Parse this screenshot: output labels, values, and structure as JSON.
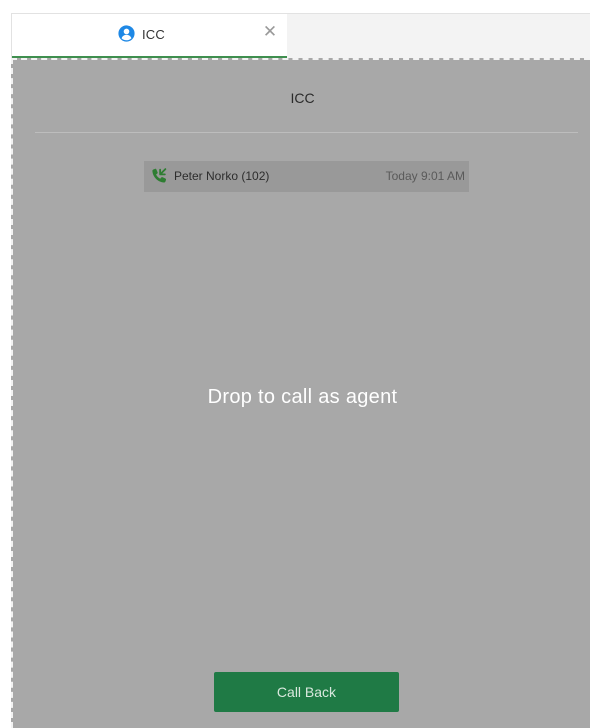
{
  "tab": {
    "label": "ICC",
    "icon": "user-circle-icon",
    "close_icon": "close-icon",
    "active_color": "#3f8f4f",
    "icon_color": "#1e88e5"
  },
  "panel": {
    "title": "ICC"
  },
  "call_history": [
    {
      "caller": "Peter Norko (102)",
      "time": "Today 9:01 AM",
      "icon": "incoming-call-icon",
      "icon_color": "#2e7d32"
    }
  ],
  "drop_overlay": {
    "message": "Drop to call as agent",
    "background": "#a8a8a8"
  },
  "actions": {
    "call_back_label": "Call Back",
    "call_back_color": "#1f7a45"
  }
}
